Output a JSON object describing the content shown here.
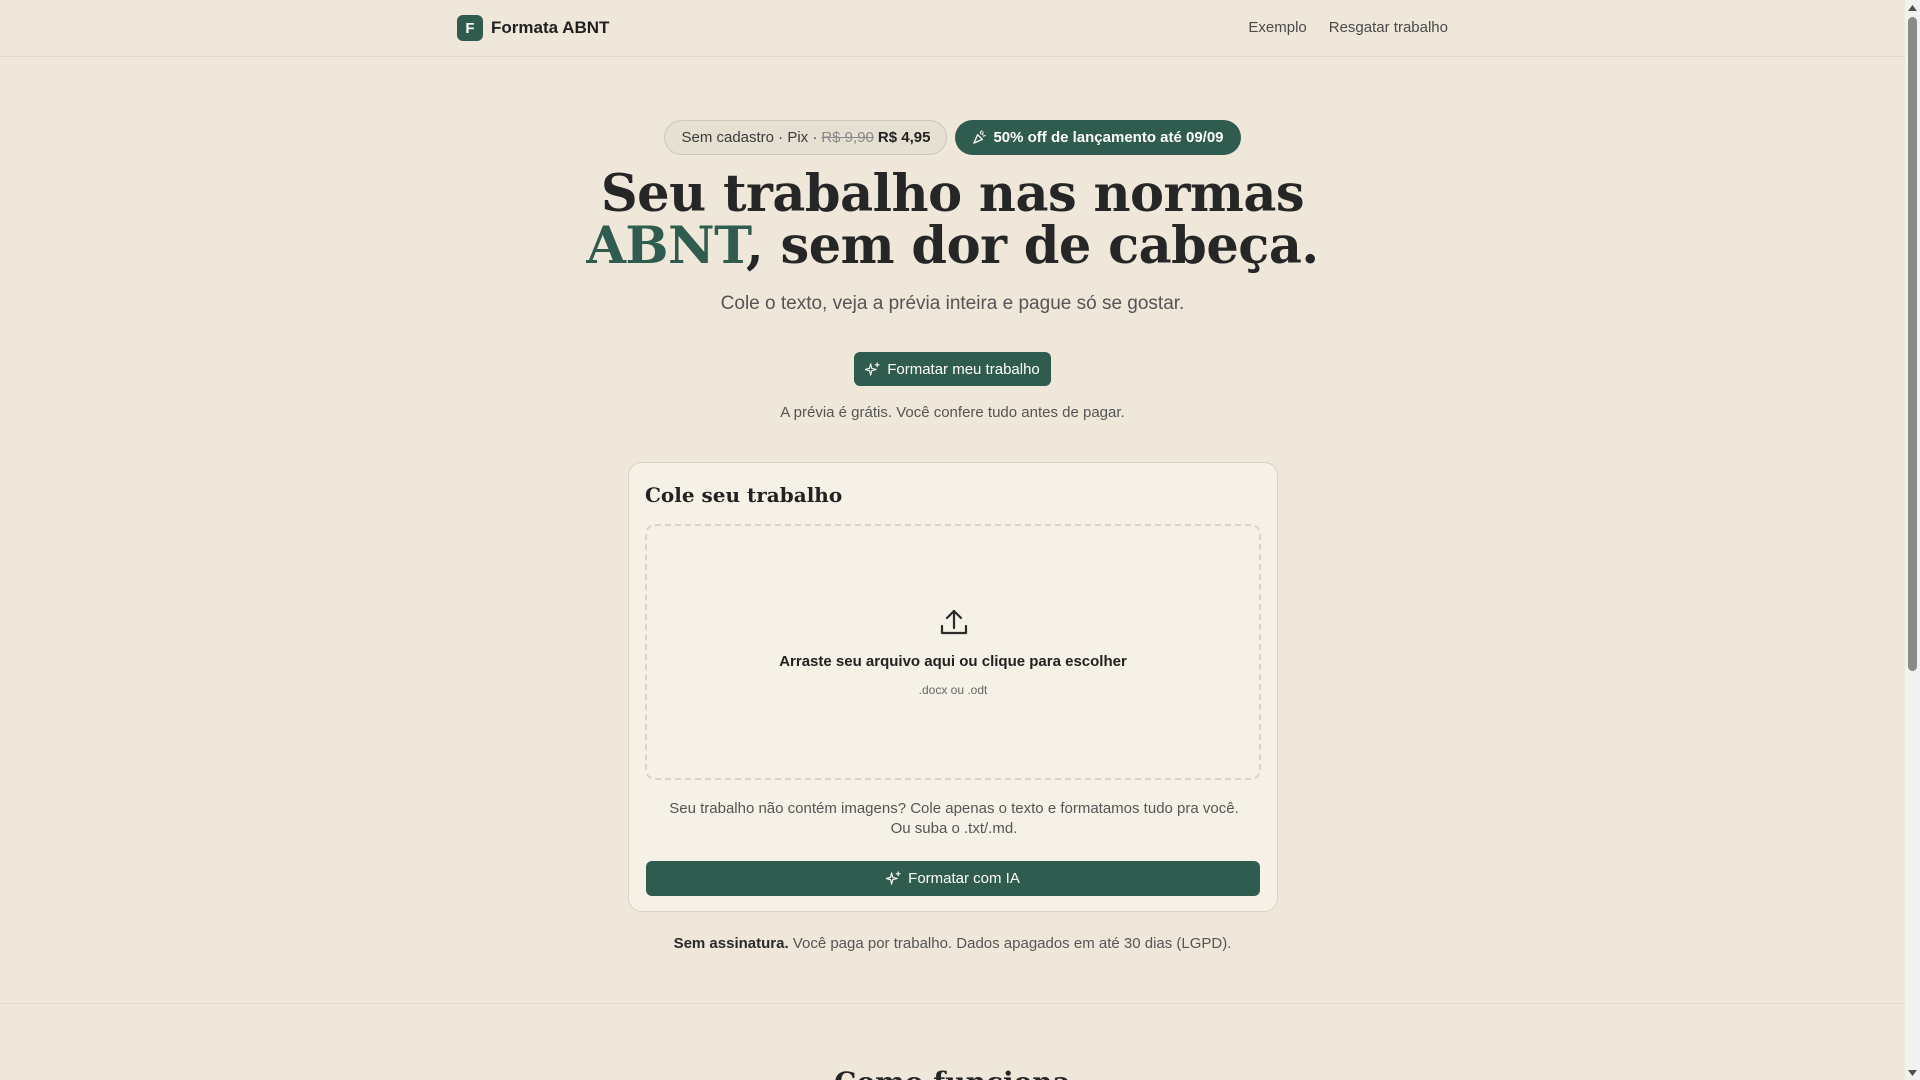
{
  "brand": {
    "logo_letter": "F",
    "name": "Formata ABNT"
  },
  "nav": {
    "items": [
      "Exemplo",
      "Resgatar trabalho"
    ]
  },
  "badges": {
    "left_prefix": "Sem cadastro · Pix ·",
    "old_price": "R$ 9,90",
    "new_price": "R$ 4,95",
    "promo": "50% off de lançamento até 09/09",
    "promo_icon": "party-popper-icon"
  },
  "hero": {
    "title_line1": "Seu trabalho nas normas",
    "title_accent": "ABNT",
    "title_rest": ", sem dor de cabeça.",
    "subtitle": "Cole o texto, veja a prévia inteira e pague só se gostar.",
    "cta_label": "Formatar meu trabalho",
    "cta_note": "A prévia é grátis. Você confere tudo antes de pagar."
  },
  "card": {
    "title": "Cole seu trabalho",
    "dropzone_title": "Arraste seu arquivo aqui ou clique para escolher",
    "dropzone_hint": ".docx ou .odt",
    "note": "Seu trabalho não contém imagens? Cole apenas o texto e formatamos tudo pra você. Ou suba o .txt/.md.",
    "button_label": "Formatar com IA"
  },
  "footnote": {
    "bold": "Sem assinatura.",
    "rest": " Você paga por trabalho. Dados apagados em até 30 dias (LGPD)."
  },
  "next_section": {
    "title": "Como funciona"
  },
  "colors": {
    "accent": "#2f5c4e",
    "background": "#eee7da",
    "card": "#f6f1e7"
  }
}
